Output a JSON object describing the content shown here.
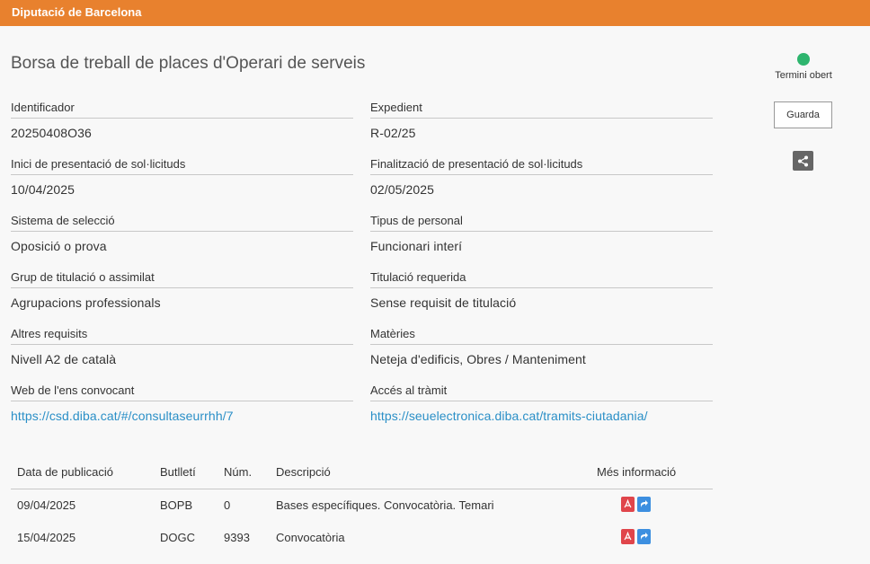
{
  "header": {
    "org": "Diputació de Barcelona"
  },
  "title": "Borsa de treball de places d'Operari de serveis",
  "status": {
    "label": "Termini obert",
    "color": "#2eb56e"
  },
  "actions": {
    "save_label": "Guarda",
    "share_icon": "share-icon"
  },
  "fields": {
    "identificador": {
      "label": "Identificador",
      "value": "20250408O36"
    },
    "expedient": {
      "label": "Expedient",
      "value": "R-02/25"
    },
    "inici": {
      "label": "Inici de presentació de sol·licituds",
      "value": "10/04/2025"
    },
    "final": {
      "label": "Finalització de presentació de sol·licituds",
      "value": "02/05/2025"
    },
    "sistema": {
      "label": "Sistema de selecció",
      "value": "Oposició o prova"
    },
    "tipus": {
      "label": "Tipus de personal",
      "value": "Funcionari interí"
    },
    "grup": {
      "label": "Grup de titulació o assimilat",
      "value": "Agrupacions professionals"
    },
    "titulacio": {
      "label": "Titulació requerida",
      "value": "Sense requisit de titulació"
    },
    "altres": {
      "label": "Altres requisits",
      "value": "Nivell A2 de català"
    },
    "materies": {
      "label": "Matèries",
      "value": "Neteja d'edificis, Obres / Manteniment"
    },
    "web": {
      "label": "Web de l'ens convocant",
      "value": "https://csd.diba.cat/#/consultaseurrhh/7"
    },
    "tramit": {
      "label": "Accés al tràmit",
      "value": "https://seuelectronica.diba.cat/tramits-ciutadania/"
    }
  },
  "table": {
    "headers": [
      "Data de publicació",
      "Butlletí",
      "Núm.",
      "Descripció",
      "Més informació"
    ],
    "rows": [
      {
        "date": "09/04/2025",
        "butlleti": "BOPB",
        "num": "0",
        "desc": "Bases específiques. Convocatòria. Temari"
      },
      {
        "date": "15/04/2025",
        "butlleti": "DOGC",
        "num": "9393",
        "desc": "Convocatòria"
      }
    ]
  }
}
